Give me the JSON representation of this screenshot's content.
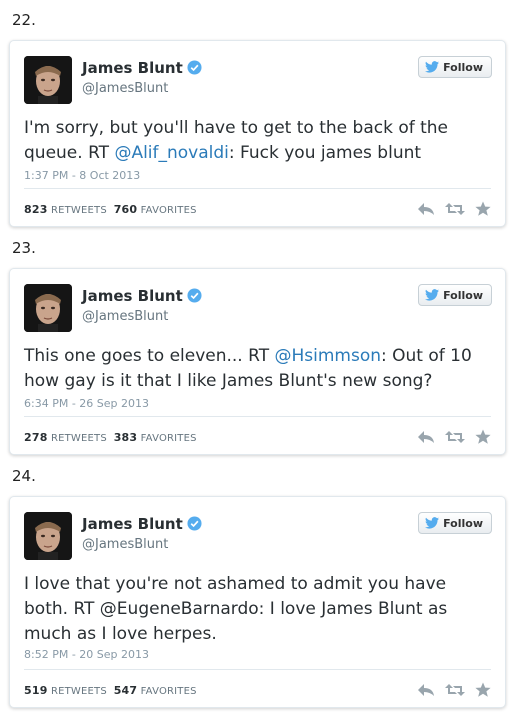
{
  "colors": {
    "link": "#2b7bb9",
    "verified": "#55acee",
    "muted": "#8899a6"
  },
  "tweets": [
    {
      "number": "22.",
      "name": "James Blunt",
      "handle": "@JamesBlunt",
      "follow_label": "Follow",
      "text_before": "I'm sorry, but you'll have to get to the back of the queue. RT ",
      "text_link": "@Alif_novaldi",
      "text_after": ": Fuck you james blunt",
      "time": "1:37 PM - 8 Oct 2013",
      "retweets": "823",
      "retweets_label": "RETWEETS",
      "favorites": "760",
      "favorites_label": "FAVORITES"
    },
    {
      "number": "23.",
      "name": "James Blunt",
      "handle": "@JamesBlunt",
      "follow_label": "Follow",
      "text_before": "This one goes to eleven... RT ",
      "text_link": "@Hsimmson",
      "text_after": ": Out of 10 how gay is it that I like James Blunt's new song?",
      "time": "6:34 PM - 26 Sep 2013",
      "retweets": "278",
      "retweets_label": "RETWEETS",
      "favorites": "383",
      "favorites_label": "FAVORITES"
    },
    {
      "number": "24.",
      "name": "James Blunt",
      "handle": "@JamesBlunt",
      "follow_label": "Follow",
      "text_before": "I love that you're not ashamed to admit you have both. RT @EugeneBarnardo: I love James Blunt as much as I love herpes.",
      "text_link": "",
      "text_after": "",
      "time": "8:52 PM - 20 Sep 2013",
      "retweets": "519",
      "retweets_label": "RETWEETS",
      "favorites": "547",
      "favorites_label": "FAVORITES"
    }
  ]
}
